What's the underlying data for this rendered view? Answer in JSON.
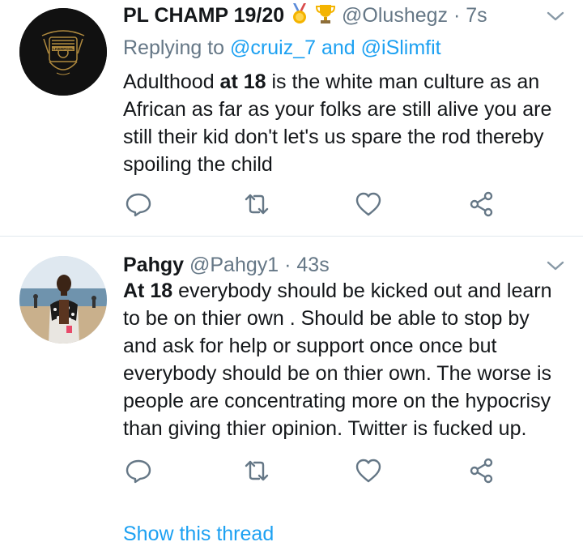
{
  "tweets": [
    {
      "display_name": "PL CHAMP 19/20",
      "handle": "@Olushegz",
      "separator": "·",
      "time": "7s",
      "reply_prefix": "Replying to",
      "reply_mention_1": "@cruiz_7",
      "reply_and": "and",
      "reply_mention_2": "@iSlimfit",
      "text_bold": "at 18",
      "text_before": "Adulthood ",
      "text_after": " is the white man culture as an African as far as your folks are still alive you are still their kid don't let's us spare the rod thereby spoiling the child",
      "avatar_icon": "liverpool-crest",
      "badges": [
        "medal-icon",
        "trophy-icon"
      ]
    },
    {
      "display_name": "Pahgy",
      "handle": "@Pahgy1",
      "separator": "·",
      "time": "43s",
      "text_bold": "At 18",
      "text_after": " everybody should be kicked out and learn to be on thier own . Should be able to stop by and ask for help or support once once but everybody should be on thier own. The worse is people are concentrating more on the hypocrisy than giving thier opinion.  Twitter is fucked up.",
      "avatar_icon": "profile-photo"
    }
  ],
  "show_thread": "Show this thread",
  "colors": {
    "accent": "#1da1f2",
    "muted": "#657786",
    "text": "#14171a",
    "divider": "#e1e8ed"
  }
}
